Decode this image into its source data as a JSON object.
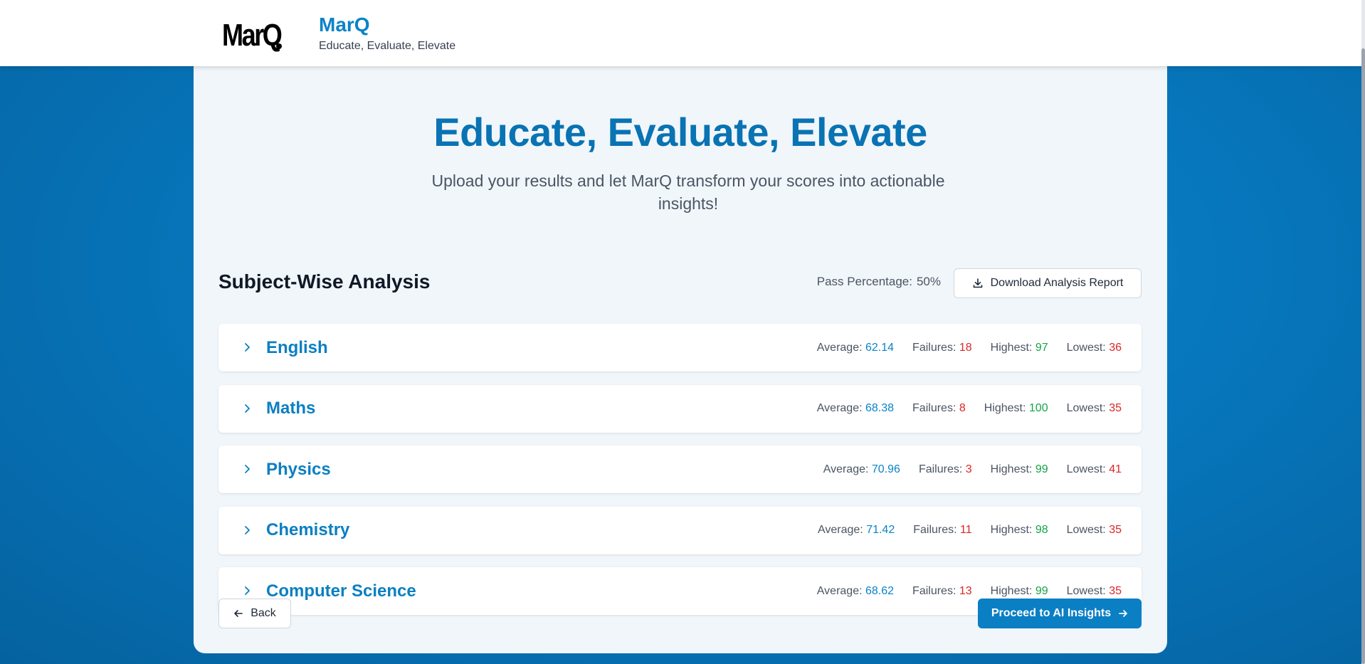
{
  "header": {
    "logo_text": "MarQ",
    "brand_name": "MarQ",
    "tagline": "Educate, Evaluate, Elevate"
  },
  "hero": {
    "title": "Educate, Evaluate, Elevate",
    "subtitle": "Upload your results and let MarQ transform your scores into actionable insights!"
  },
  "analysis": {
    "title": "Subject-Wise Analysis",
    "pass_label": "Pass Percentage:",
    "pass_value": "50%",
    "download_label": "Download Analysis Report",
    "labels": {
      "average": "Average:",
      "failures": "Failures:",
      "highest": "Highest:",
      "lowest": "Lowest:"
    },
    "subjects": [
      {
        "name": "English",
        "average": "62.14",
        "failures": "18",
        "highest": "97",
        "lowest": "36"
      },
      {
        "name": "Maths",
        "average": "68.38",
        "failures": "8",
        "highest": "100",
        "lowest": "35"
      },
      {
        "name": "Physics",
        "average": "70.96",
        "failures": "3",
        "highest": "99",
        "lowest": "41"
      },
      {
        "name": "Chemistry",
        "average": "71.42",
        "failures": "11",
        "highest": "98",
        "lowest": "35"
      },
      {
        "name": "Computer Science",
        "average": "68.62",
        "failures": "13",
        "highest": "99",
        "lowest": "35"
      }
    ]
  },
  "footer": {
    "back_label": "Back",
    "proceed_label": "Proceed to AI Insights"
  },
  "colors": {
    "primary": "#0a7fc4",
    "failure": "#dc2626",
    "highest": "#16a34a"
  },
  "icons": [
    "chevron-right-icon",
    "download-icon",
    "arrow-left-icon",
    "arrow-right-icon"
  ]
}
